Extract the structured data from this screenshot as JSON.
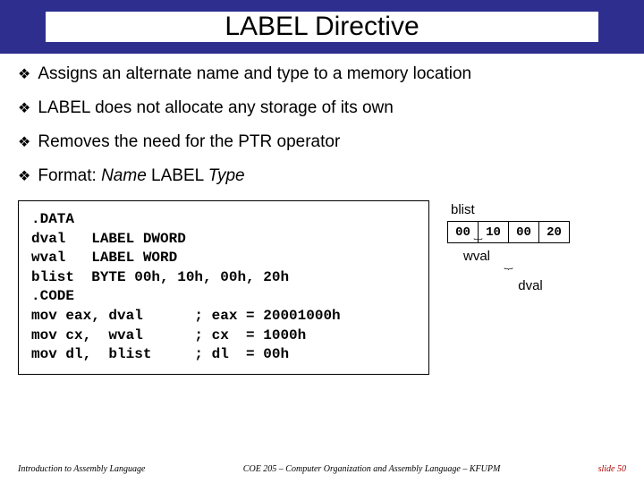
{
  "title": "LABEL Directive",
  "bullets": [
    "Assigns an alternate name and type to a memory location",
    "LABEL does not allocate any storage of its own",
    "Removes the need for the PTR operator"
  ],
  "format_prefix": "Format: ",
  "format_name": "Name",
  "format_mid": " LABEL ",
  "format_type": "Type",
  "code": ".DATA\ndval   LABEL DWORD\nwval   LABEL WORD\nblist  BYTE 00h, 10h, 00h, 20h\n.CODE\nmov eax, dval      ; eax = 20001000h\nmov cx,  wval      ; cx  = 1000h\nmov dl,  blist     ; dl  = 00h",
  "diagram": {
    "blist_label": "blist",
    "cells": [
      "00",
      "10",
      "00",
      "20"
    ],
    "wval_label": "wval",
    "dval_label": "dval"
  },
  "footer": {
    "left": "Introduction to Assembly Language",
    "center": "COE 205 – Computer Organization and Assembly Language – KFUPM",
    "right": "slide 50"
  }
}
